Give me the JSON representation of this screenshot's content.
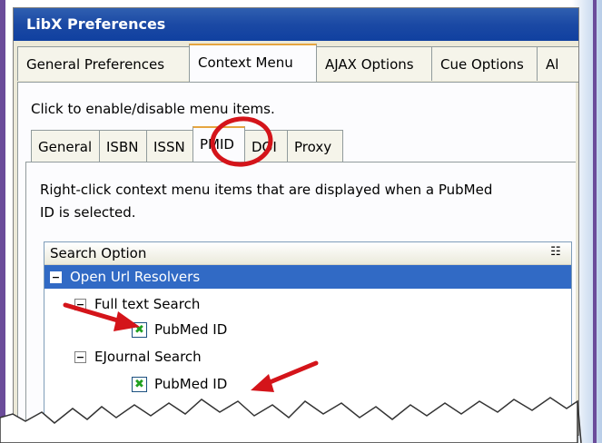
{
  "window": {
    "title": "LibX Preferences"
  },
  "main_tabs": [
    {
      "label": "General Preferences"
    },
    {
      "label": "Context Menu"
    },
    {
      "label": "AJAX Options"
    },
    {
      "label": "Cue Options"
    },
    {
      "label": "Al"
    }
  ],
  "hint": "Click to enable/disable menu items.",
  "sub_tabs": [
    {
      "label": "General"
    },
    {
      "label": "ISBN"
    },
    {
      "label": "ISSN"
    },
    {
      "label": "PMID"
    },
    {
      "label": "DOI"
    },
    {
      "label": "Proxy"
    }
  ],
  "description": "Right-click context menu items that are displayed when a PubMed ID is selected.",
  "tree": {
    "header": "Search Option",
    "rows": [
      {
        "label": "Open Url Resolvers",
        "kind": "group",
        "selected": true
      },
      {
        "label": "Full text Search",
        "kind": "group"
      },
      {
        "label": "PubMed ID",
        "kind": "checkbox",
        "checked": true
      },
      {
        "label": "EJournal Search",
        "kind": "group"
      },
      {
        "label": "PubMed ID",
        "kind": "checkbox",
        "checked": true
      }
    ]
  },
  "icons": {
    "expander": "collapse-icon",
    "checkbox": "checked-icon",
    "column_picker": "column-picker-icon"
  },
  "colors": {
    "titlebar": "#1b49a4",
    "selection": "#316ac5",
    "annotation": "#d4141a",
    "frame": "#6b4c9a"
  }
}
